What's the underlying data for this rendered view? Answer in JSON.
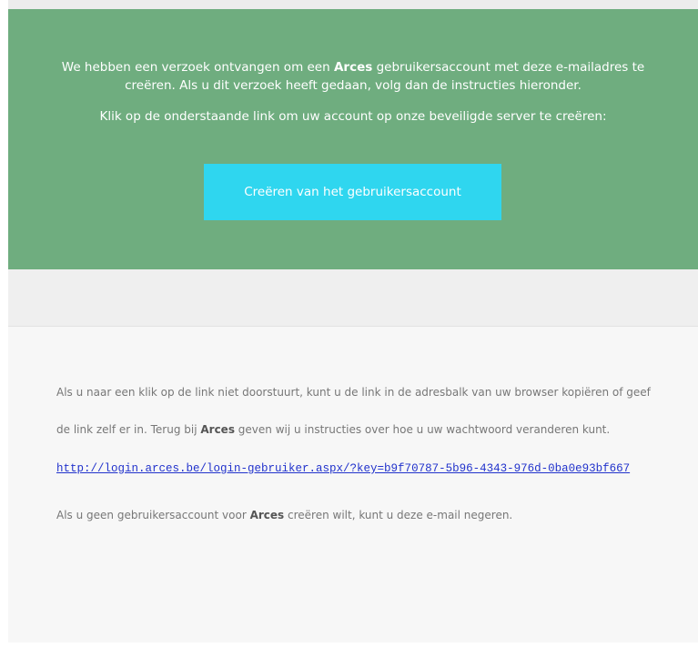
{
  "hero": {
    "intro_before": "We hebben een verzoek ontvangen om een ",
    "brand": "Arces",
    "intro_after": " gebruikersaccount met deze e-mailadres te creëren. Als u dit verzoek heeft gedaan, volg dan de instructies hieronder.",
    "instruction": "Klik op de onderstaande link om uw account op onze beveiligde server te creëren:",
    "button_label": "Creëren van het gebruikersaccount",
    "background_color": "#6fad7f",
    "button_color": "#2fd6ef"
  },
  "content": {
    "para1_before": "Als u naar een klik op de link niet doorstuurt, kunt u de link in de adresbalk van uw browser kopiëren of geef de link zelf er in. Terug bij ",
    "para1_brand": "Arces",
    "para1_after": " geven wij u instructies over hoe u uw wachtwoord veranderen kunt.",
    "link_url": "http://login.arces.be/login-gebruiker.aspx/?key=b9f70787-5b96-4343-976d-0ba0e93bf667",
    "para2_before": "Als u geen gebruikersaccount voor ",
    "para2_brand": "Arces",
    "para2_after": " creëren wilt, kunt u deze e-mail negeren.",
    "link_color": "#2233cc"
  }
}
